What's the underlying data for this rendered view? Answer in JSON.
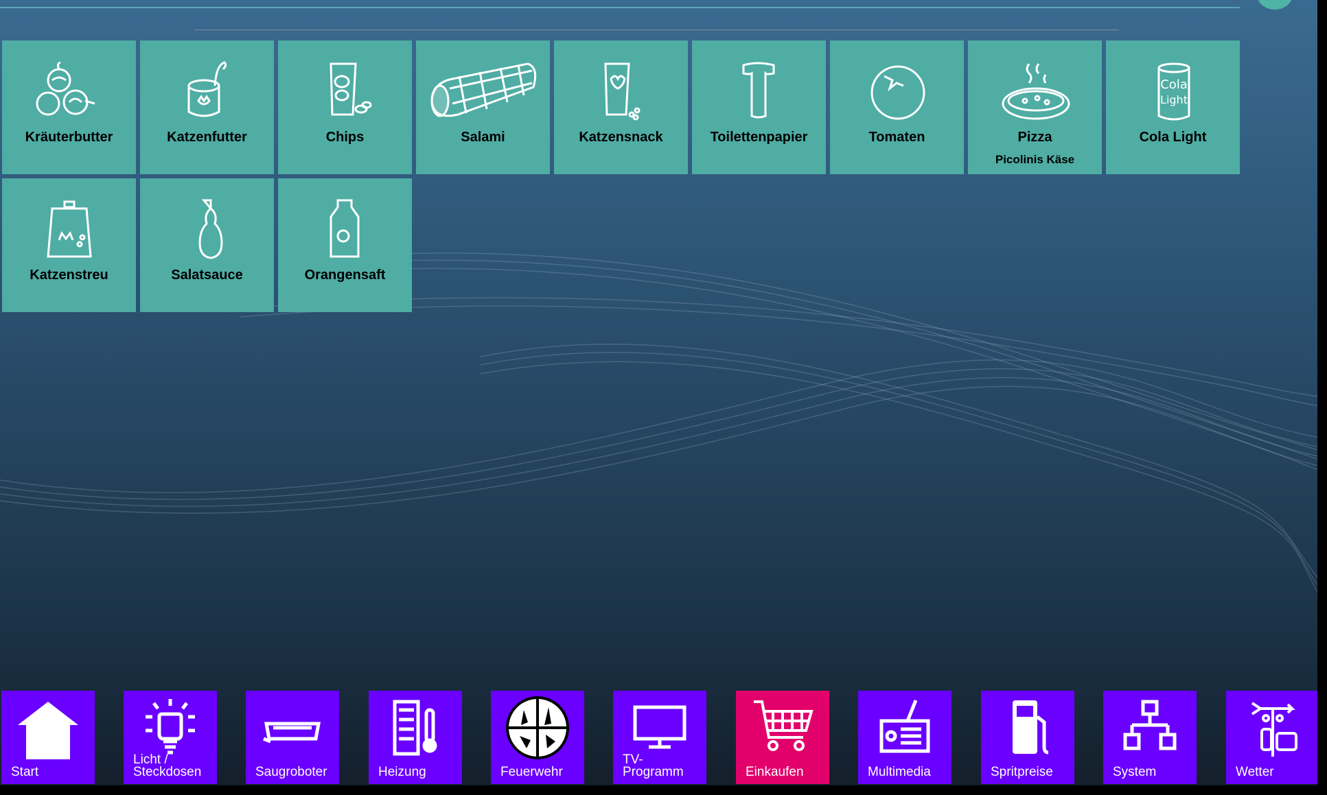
{
  "colors": {
    "tile": "#4fada4",
    "nav": "#6a00ff",
    "nav_active": "#e2006a"
  },
  "shopping_items": [
    {
      "label": "Kräuterbutter",
      "sub": "",
      "icon": "garlic-icon"
    },
    {
      "label": "Katzenfutter",
      "sub": "",
      "icon": "cat-food-can-icon"
    },
    {
      "label": "Chips",
      "sub": "",
      "icon": "chips-bag-icon"
    },
    {
      "label": "Salami",
      "sub": "",
      "icon": "salami-icon"
    },
    {
      "label": "Katzensnack",
      "sub": "",
      "icon": "snack-bag-icon"
    },
    {
      "label": "Toilettenpapier",
      "sub": "",
      "icon": "toilet-paper-icon"
    },
    {
      "label": "Tomaten",
      "sub": "",
      "icon": "tomato-icon"
    },
    {
      "label": "Pizza",
      "sub": "Picolinis Käse",
      "icon": "pizza-icon"
    },
    {
      "label": "Cola Light",
      "sub": "",
      "icon": "cola-can-icon"
    },
    {
      "label": "Katzenstreu",
      "sub": "",
      "icon": "cat-litter-icon"
    },
    {
      "label": "Salatsauce",
      "sub": "",
      "icon": "sauce-bottle-icon"
    },
    {
      "label": "Orangensaft",
      "sub": "",
      "icon": "juice-carton-icon"
    }
  ],
  "cola_icon_text": [
    "Cola",
    "Light"
  ],
  "nav": [
    {
      "label": "Start",
      "icon": "home-icon"
    },
    {
      "label": "Licht /\nSteckdosen",
      "icon": "light-bulb-icon"
    },
    {
      "label": "Saugroboter",
      "icon": "robot-vacuum-icon"
    },
    {
      "label": "Heizung",
      "icon": "heater-icon"
    },
    {
      "label": "Feuerwehr",
      "icon": "fire-brigade-icon"
    },
    {
      "label": "TV-\nProgramm",
      "icon": "tv-icon"
    },
    {
      "label": "Einkaufen",
      "icon": "shopping-cart-icon",
      "active": true
    },
    {
      "label": "Multimedia",
      "icon": "radio-icon"
    },
    {
      "label": "Spritpreise",
      "icon": "fuel-pump-icon"
    },
    {
      "label": "System",
      "icon": "network-icon"
    },
    {
      "label": "Wetter",
      "icon": "weather-vane-icon"
    }
  ]
}
